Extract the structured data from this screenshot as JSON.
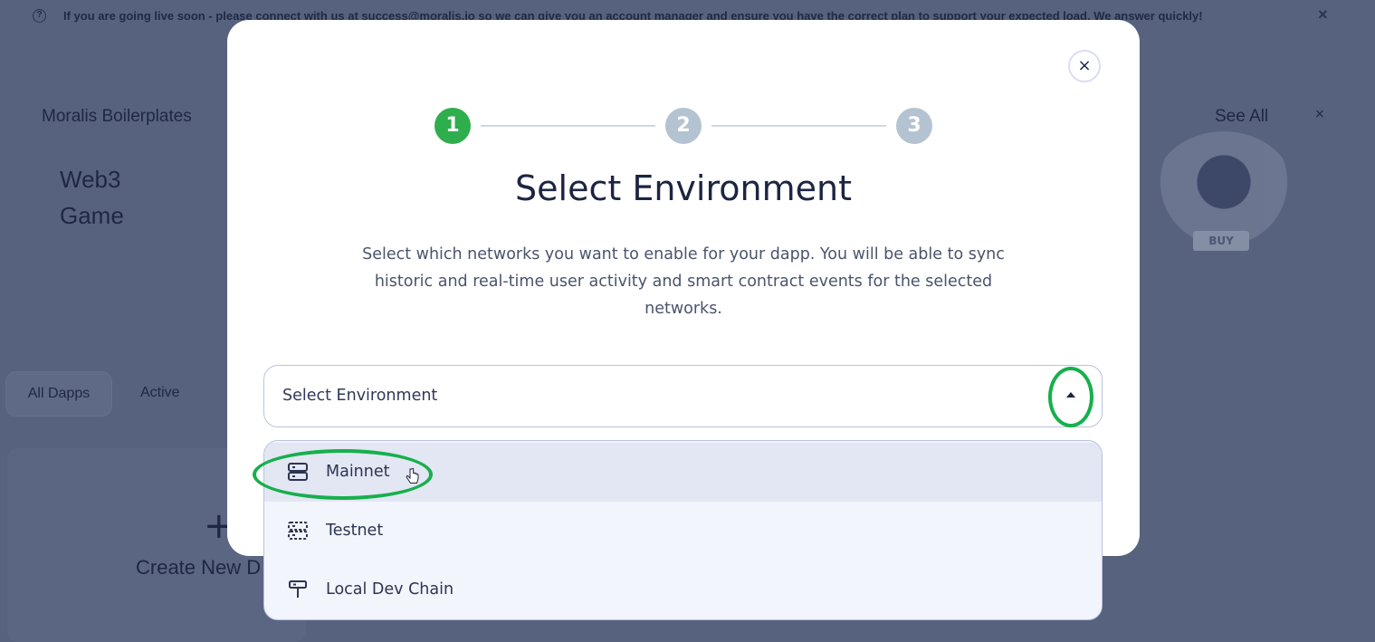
{
  "banner": {
    "text": "If you are going live soon - please connect with us at success@moralis.io so we can give you an account manager and ensure you have the correct plan to support your expected load. We answer quickly!",
    "close": "×"
  },
  "background": {
    "section_title": "Moralis Boilerplates",
    "see_all": "See All",
    "close_small": "×",
    "card_title_line1": "Web3",
    "card_title_line2": "Game",
    "game_badge": "BUY",
    "tabs": [
      "All Dapps",
      "Active"
    ],
    "create_plus": "+",
    "create_label": "Create New D"
  },
  "modal": {
    "close": "×",
    "steps": [
      "1",
      "2",
      "3"
    ],
    "active_step": 1,
    "title": "Select Environment",
    "description": "Select which networks you want to enable for your dapp. You will be able to sync historic and real-time user activity and smart contract events for the selected networks.",
    "select": {
      "placeholder": "Select Environment",
      "expanded": true
    },
    "options": [
      {
        "label": "Mainnet",
        "icon": "server-icon",
        "hovered": true
      },
      {
        "label": "Testnet",
        "icon": "server-dashed-icon",
        "hovered": false
      },
      {
        "label": "Local Dev Chain",
        "icon": "plug-icon",
        "hovered": false
      }
    ]
  },
  "colors": {
    "step_active": "#2eae4c",
    "step_inactive": "#b3c3d1",
    "highlight": "#16b04c",
    "overlay_bg": "#56627e"
  }
}
